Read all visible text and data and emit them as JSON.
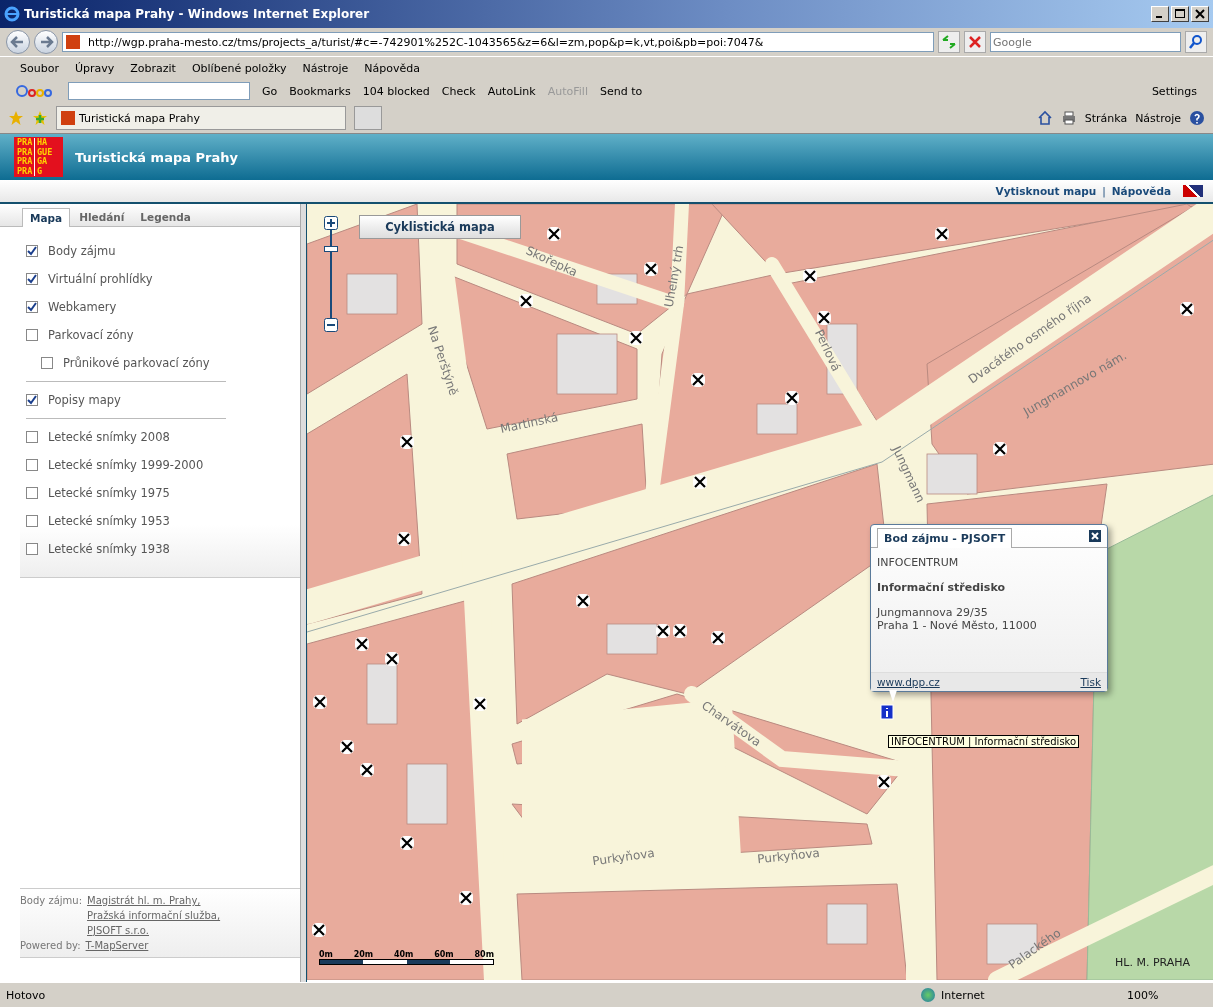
{
  "window": {
    "title": "Turistická mapa Prahy - Windows Internet Explorer"
  },
  "address_bar": {
    "url": "http://wgp.praha-mesto.cz/tms/projects_a/turist/#c=-742901%252C-1043565&z=6&l=zm,pop&p=k,vt,poi&pb=poi:7047&",
    "search_placeholder": "Google"
  },
  "menu_bar": [
    "Soubor",
    "Úpravy",
    "Zobrazit",
    "Oblíbené položky",
    "Nástroje",
    "Nápověda"
  ],
  "google_toolbar": {
    "go": "Go",
    "items": [
      {
        "label": "Bookmarks",
        "disabled": false
      },
      {
        "label": "104 blocked",
        "disabled": false
      },
      {
        "label": "Check",
        "disabled": false
      },
      {
        "label": "AutoLink",
        "disabled": false
      },
      {
        "label": "AutoFill",
        "disabled": true
      },
      {
        "label": "Send to",
        "disabled": false
      }
    ],
    "settings": "Settings"
  },
  "tab": {
    "title": "Turistická mapa Prahy"
  },
  "command_bar": [
    "Stránka",
    "Nástroje"
  ],
  "site_header": {
    "logo_lines": [
      [
        "PRA",
        "HA"
      ],
      [
        "PRA",
        "GUE"
      ],
      [
        "PRA",
        "GA"
      ],
      [
        "PRA",
        "G"
      ]
    ],
    "title": "Turistická mapa Prahy",
    "links": [
      "Vytisknout mapu",
      "Nápověda"
    ],
    "link_separator": "|"
  },
  "sidebar": {
    "tabs": [
      {
        "label": "Mapa",
        "selected": true
      },
      {
        "label": "Hledání",
        "selected": false
      },
      {
        "label": "Legenda",
        "selected": false
      }
    ],
    "layer_groups": [
      [
        {
          "label": "Body zájmu",
          "checked": true
        },
        {
          "label": "Virtuální prohlídky",
          "checked": true
        },
        {
          "label": "Webkamery",
          "checked": true
        },
        {
          "label": "Parkovací zóny",
          "checked": false,
          "children": [
            {
              "label": "Průnikové parkovací zóny",
              "checked": false
            }
          ]
        }
      ],
      [
        {
          "label": "Popisy mapy",
          "checked": true
        }
      ],
      [
        {
          "label": "Letecké snímky 2008",
          "checked": false
        },
        {
          "label": "Letecké snímky 1999-2000",
          "checked": false
        },
        {
          "label": "Letecké snímky 1975",
          "checked": false
        },
        {
          "label": "Letecké snímky 1953",
          "checked": false
        },
        {
          "label": "Letecké snímky 1938",
          "checked": false
        }
      ]
    ],
    "credits": {
      "label": "Body zájmu:",
      "links": [
        "Magistrát hl. m. Prahy,",
        "Pražská informační služba,",
        "PJSOFT s.r.o."
      ],
      "powered_label": "Powered by:",
      "powered_link": "T-MapServer"
    }
  },
  "map": {
    "layer_button": "Cyklistická mapa",
    "zoom_slider": {
      "level": 0.8
    },
    "streets": [
      "Skořepka",
      "Uhelný trh",
      "Na Perštýně",
      "Perlová",
      "Martinská",
      "Dvacátého osmého října",
      "Jungmannovo nám.",
      "Jungmann",
      "Charvátova",
      "Purkyňova",
      "Purkyňova",
      "Palackého"
    ],
    "popup": {
      "title": "Bod zájmu - PJSOFT",
      "category": "INFOCENTRUM",
      "name": "Informační středisko",
      "address": [
        "Jungmannova 29/35",
        "Praha 1 - Nové Město, 11000"
      ],
      "link": "www.dpp.cz",
      "print": "Tisk"
    },
    "tooltip": "INFOCENTRUM | Informační středisko",
    "scale_labels": [
      "0m",
      "20m",
      "40m",
      "60m",
      "80m"
    ],
    "copyright": "HL. M. PRAHA"
  },
  "status_bar": {
    "text": "Hotovo",
    "zone": "Internet",
    "zoom": "100%"
  }
}
